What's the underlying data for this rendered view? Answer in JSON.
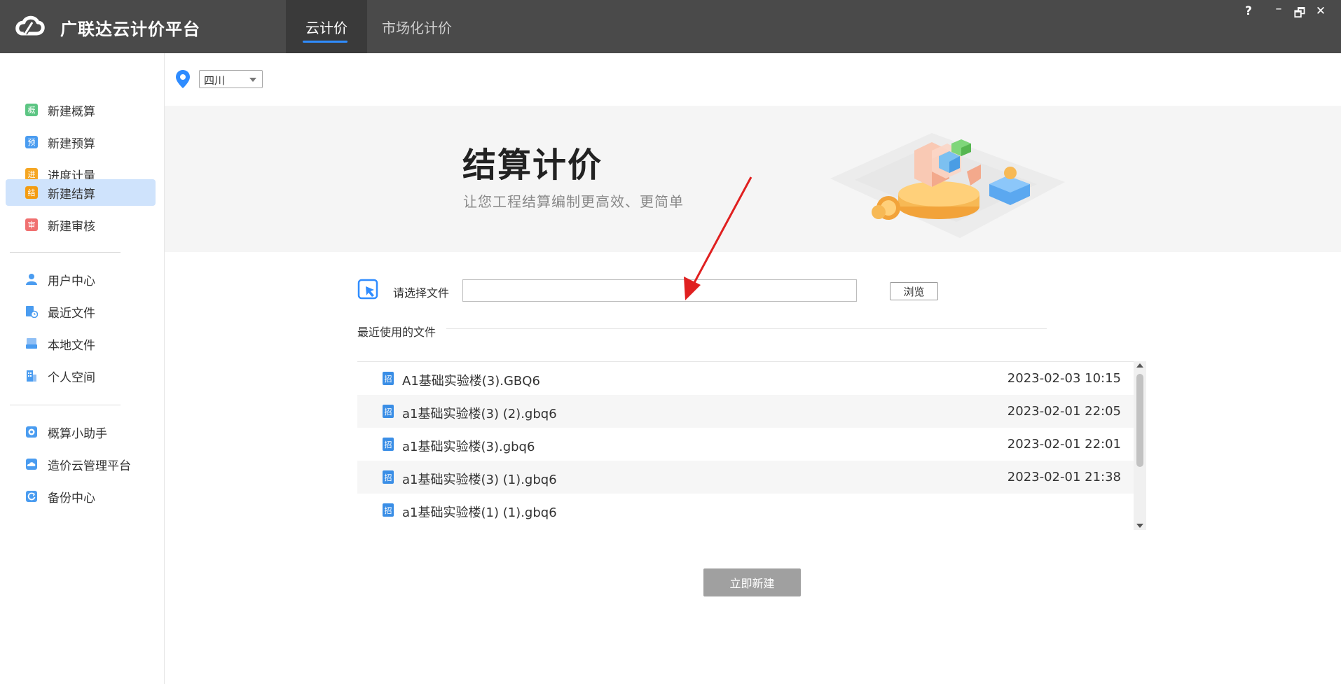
{
  "app": {
    "title": "广联达云计价平台"
  },
  "tabs": [
    {
      "label": "云计价",
      "active": true
    },
    {
      "label": "市场化计价",
      "active": false
    }
  ],
  "window_controls": {
    "help": "?",
    "minimize": "–",
    "maximize": "🗗",
    "close": "✕"
  },
  "region": {
    "selected": "四川"
  },
  "sidebar": {
    "group1": [
      {
        "label": "新建概算",
        "icon": "gai-icon",
        "glyph": "概",
        "color": "#5cc583"
      },
      {
        "label": "新建预算",
        "icon": "yu-icon",
        "glyph": "预",
        "color": "#4a9cf0"
      },
      {
        "label": "进度计量",
        "icon": "jin-icon",
        "glyph": "进",
        "color": "#f5a623"
      },
      {
        "label": "新建结算",
        "icon": "jie-icon",
        "glyph": "结",
        "color": "#f39c12",
        "active": true
      },
      {
        "label": "新建审核",
        "icon": "shen-icon",
        "glyph": "审",
        "color": "#f07070"
      }
    ],
    "group2": [
      {
        "label": "用户中心",
        "icon": "user-icon"
      },
      {
        "label": "最近文件",
        "icon": "recent-file-icon"
      },
      {
        "label": "本地文件",
        "icon": "local-file-icon"
      },
      {
        "label": "个人空间",
        "icon": "personal-space-icon"
      }
    ],
    "group3": [
      {
        "label": "概算小助手",
        "icon": "assistant-icon"
      },
      {
        "label": "造价云管理平台",
        "icon": "cloud-platform-icon"
      },
      {
        "label": "备份中心",
        "icon": "backup-icon"
      }
    ]
  },
  "banner": {
    "title": "结算计价",
    "subtitle": "让您工程结算编制更高效、更简单"
  },
  "file_select": {
    "label": "请选择文件",
    "value": "",
    "browse_label": "浏览"
  },
  "recent": {
    "title": "最近使用的文件",
    "files": [
      {
        "name": "A1基础实验楼(3).GBQ6",
        "date": "2023-02-03 10:15"
      },
      {
        "name": "a1基础实验楼(3) (2).gbq6",
        "date": "2023-02-01 22:05"
      },
      {
        "name": "a1基础实验楼(3).gbq6",
        "date": "2023-02-01 22:01"
      },
      {
        "name": "a1基础实验楼(3) (1).gbq6",
        "date": "2023-02-01 21:38"
      },
      {
        "name": "a1基础实验楼(1) (1).gbq6",
        "date": ""
      }
    ]
  },
  "file_icon_glyph": "招",
  "create_button": {
    "label": "立即新建"
  },
  "colors": {
    "accent": "#2f8cff",
    "titlebar": "#4a4a4a",
    "active_side": "#cfe3fc",
    "disabled_button": "#a0a0a0"
  }
}
